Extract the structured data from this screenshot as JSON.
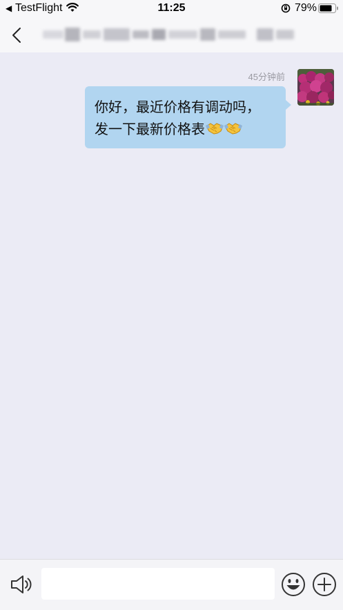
{
  "status_bar": {
    "back_glyph": "◀",
    "app": "TestFlight",
    "time": "11:25",
    "battery": "79%"
  },
  "nav": {
    "title_redacted": true
  },
  "messages": [
    {
      "time": "45分钟前",
      "sender": "self",
      "lines": [
        "你好，最近价格有调动吗，",
        "发一下最新价格表"
      ],
      "emoji": [
        "handshake-icon",
        "handshake-icon"
      ]
    }
  ],
  "input": {
    "value": "",
    "placeholder": ""
  },
  "icons": {
    "voice": "speaker-icon",
    "emoji": "smiley-icon",
    "more": "plus-circle-icon"
  },
  "colors": {
    "chat_background": "#ebebf5",
    "bubble": "#b1d5f0",
    "bar_background": "#f7f7f9"
  }
}
